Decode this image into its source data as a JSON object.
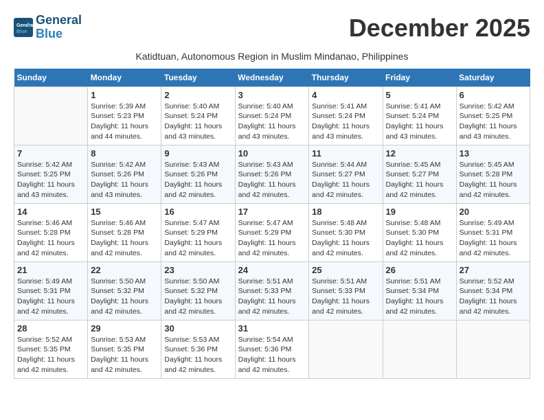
{
  "logo": {
    "line1": "General",
    "line2": "Blue"
  },
  "title": "December 2025",
  "location": "Katidtuan, Autonomous Region in Muslim Mindanao, Philippines",
  "headers": [
    "Sunday",
    "Monday",
    "Tuesday",
    "Wednesday",
    "Thursday",
    "Friday",
    "Saturday"
  ],
  "weeks": [
    [
      {
        "day": "",
        "info": ""
      },
      {
        "day": "1",
        "info": "Sunrise: 5:39 AM\nSunset: 5:23 PM\nDaylight: 11 hours\nand 44 minutes."
      },
      {
        "day": "2",
        "info": "Sunrise: 5:40 AM\nSunset: 5:24 PM\nDaylight: 11 hours\nand 43 minutes."
      },
      {
        "day": "3",
        "info": "Sunrise: 5:40 AM\nSunset: 5:24 PM\nDaylight: 11 hours\nand 43 minutes."
      },
      {
        "day": "4",
        "info": "Sunrise: 5:41 AM\nSunset: 5:24 PM\nDaylight: 11 hours\nand 43 minutes."
      },
      {
        "day": "5",
        "info": "Sunrise: 5:41 AM\nSunset: 5:24 PM\nDaylight: 11 hours\nand 43 minutes."
      },
      {
        "day": "6",
        "info": "Sunrise: 5:42 AM\nSunset: 5:25 PM\nDaylight: 11 hours\nand 43 minutes."
      }
    ],
    [
      {
        "day": "7",
        "info": "Sunrise: 5:42 AM\nSunset: 5:25 PM\nDaylight: 11 hours\nand 43 minutes."
      },
      {
        "day": "8",
        "info": "Sunrise: 5:42 AM\nSunset: 5:26 PM\nDaylight: 11 hours\nand 43 minutes."
      },
      {
        "day": "9",
        "info": "Sunrise: 5:43 AM\nSunset: 5:26 PM\nDaylight: 11 hours\nand 42 minutes."
      },
      {
        "day": "10",
        "info": "Sunrise: 5:43 AM\nSunset: 5:26 PM\nDaylight: 11 hours\nand 42 minutes."
      },
      {
        "day": "11",
        "info": "Sunrise: 5:44 AM\nSunset: 5:27 PM\nDaylight: 11 hours\nand 42 minutes."
      },
      {
        "day": "12",
        "info": "Sunrise: 5:45 AM\nSunset: 5:27 PM\nDaylight: 11 hours\nand 42 minutes."
      },
      {
        "day": "13",
        "info": "Sunrise: 5:45 AM\nSunset: 5:28 PM\nDaylight: 11 hours\nand 42 minutes."
      }
    ],
    [
      {
        "day": "14",
        "info": "Sunrise: 5:46 AM\nSunset: 5:28 PM\nDaylight: 11 hours\nand 42 minutes."
      },
      {
        "day": "15",
        "info": "Sunrise: 5:46 AM\nSunset: 5:28 PM\nDaylight: 11 hours\nand 42 minutes."
      },
      {
        "day": "16",
        "info": "Sunrise: 5:47 AM\nSunset: 5:29 PM\nDaylight: 11 hours\nand 42 minutes."
      },
      {
        "day": "17",
        "info": "Sunrise: 5:47 AM\nSunset: 5:29 PM\nDaylight: 11 hours\nand 42 minutes."
      },
      {
        "day": "18",
        "info": "Sunrise: 5:48 AM\nSunset: 5:30 PM\nDaylight: 11 hours\nand 42 minutes."
      },
      {
        "day": "19",
        "info": "Sunrise: 5:48 AM\nSunset: 5:30 PM\nDaylight: 11 hours\nand 42 minutes."
      },
      {
        "day": "20",
        "info": "Sunrise: 5:49 AM\nSunset: 5:31 PM\nDaylight: 11 hours\nand 42 minutes."
      }
    ],
    [
      {
        "day": "21",
        "info": "Sunrise: 5:49 AM\nSunset: 5:31 PM\nDaylight: 11 hours\nand 42 minutes."
      },
      {
        "day": "22",
        "info": "Sunrise: 5:50 AM\nSunset: 5:32 PM\nDaylight: 11 hours\nand 42 minutes."
      },
      {
        "day": "23",
        "info": "Sunrise: 5:50 AM\nSunset: 5:32 PM\nDaylight: 11 hours\nand 42 minutes."
      },
      {
        "day": "24",
        "info": "Sunrise: 5:51 AM\nSunset: 5:33 PM\nDaylight: 11 hours\nand 42 minutes."
      },
      {
        "day": "25",
        "info": "Sunrise: 5:51 AM\nSunset: 5:33 PM\nDaylight: 11 hours\nand 42 minutes."
      },
      {
        "day": "26",
        "info": "Sunrise: 5:51 AM\nSunset: 5:34 PM\nDaylight: 11 hours\nand 42 minutes."
      },
      {
        "day": "27",
        "info": "Sunrise: 5:52 AM\nSunset: 5:34 PM\nDaylight: 11 hours\nand 42 minutes."
      }
    ],
    [
      {
        "day": "28",
        "info": "Sunrise: 5:52 AM\nSunset: 5:35 PM\nDaylight: 11 hours\nand 42 minutes."
      },
      {
        "day": "29",
        "info": "Sunrise: 5:53 AM\nSunset: 5:35 PM\nDaylight: 11 hours\nand 42 minutes."
      },
      {
        "day": "30",
        "info": "Sunrise: 5:53 AM\nSunset: 5:36 PM\nDaylight: 11 hours\nand 42 minutes."
      },
      {
        "day": "31",
        "info": "Sunrise: 5:54 AM\nSunset: 5:36 PM\nDaylight: 11 hours\nand 42 minutes."
      },
      {
        "day": "",
        "info": ""
      },
      {
        "day": "",
        "info": ""
      },
      {
        "day": "",
        "info": ""
      }
    ]
  ]
}
